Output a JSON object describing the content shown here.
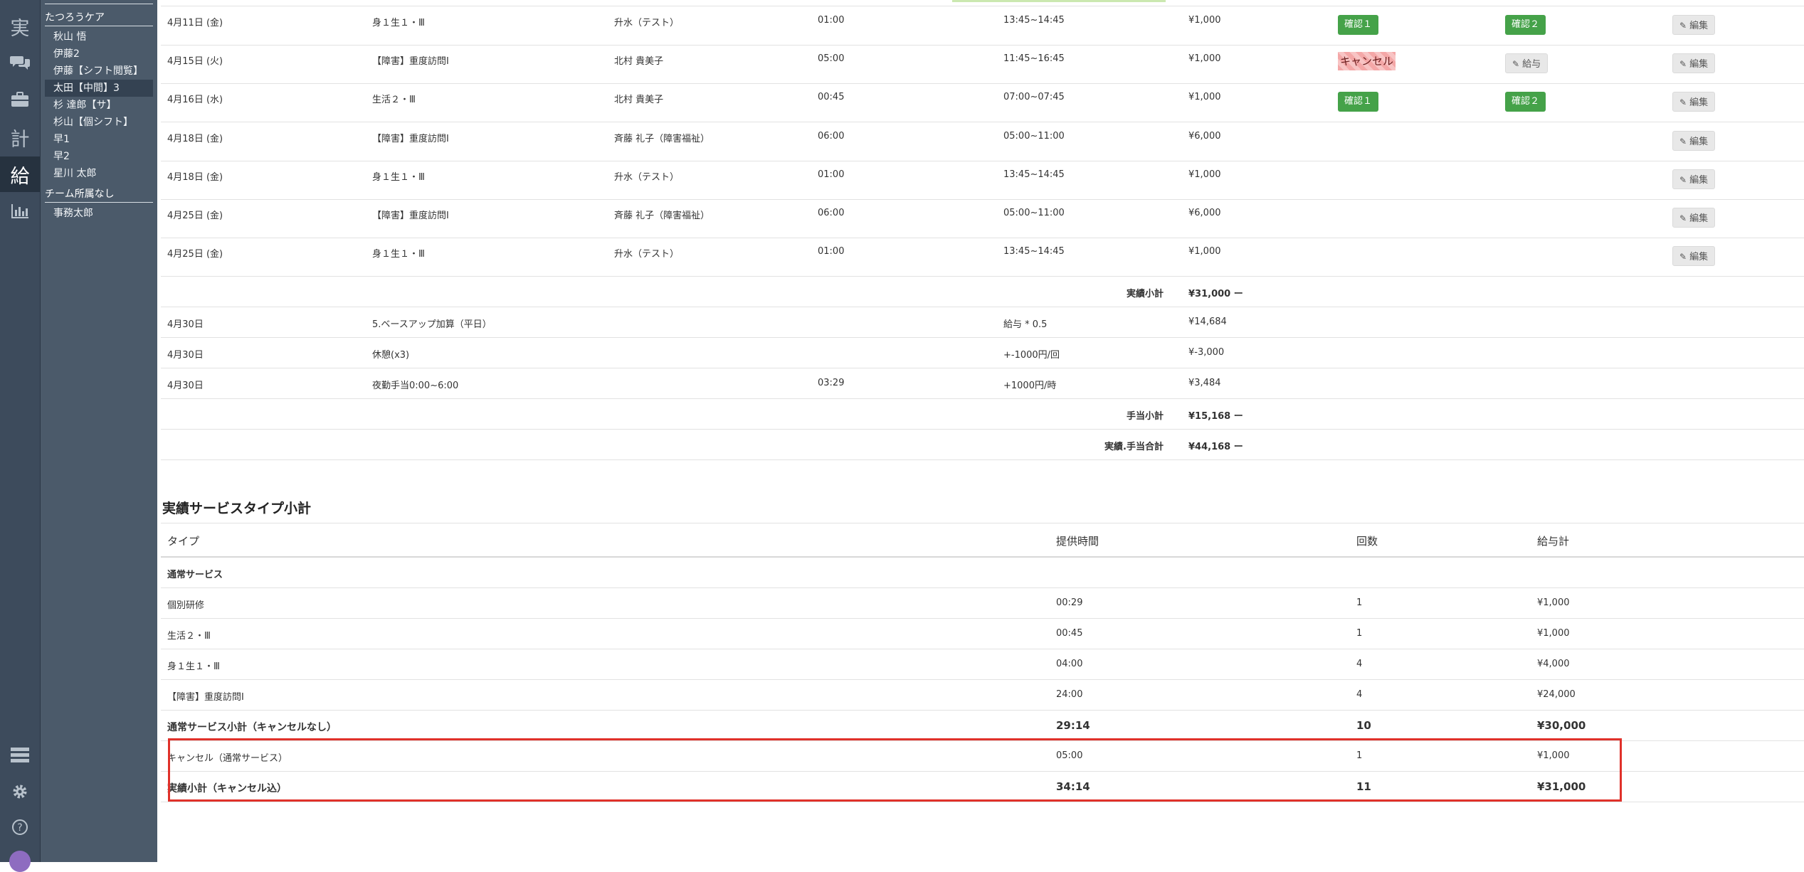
{
  "rail": {
    "items": [
      {
        "name": "rail-jisseki",
        "glyph": "実",
        "active": false
      },
      {
        "name": "rail-chat-icon",
        "glyph": "",
        "active": false
      },
      {
        "name": "rail-briefcase-icon",
        "glyph": "",
        "active": false
      },
      {
        "name": "rail-kei",
        "glyph": "計",
        "active": false
      },
      {
        "name": "rail-kyu",
        "glyph": "給",
        "active": true
      },
      {
        "name": "rail-chart-icon",
        "glyph": "",
        "active": false
      }
    ]
  },
  "sidebar": {
    "team_name": "たつろうケア",
    "members": [
      "秋山 悟",
      "伊藤2",
      "伊藤【シフト閲覧】",
      "太田【中間】3",
      "杉 達郎【サ】",
      "杉山【個シフト】",
      "早1",
      "早2",
      "星川 太郎"
    ],
    "active_member": "太田【中間】3",
    "no_team_label": "チーム所属なし",
    "no_team_members": [
      "事務太郎"
    ]
  },
  "records": [
    {
      "date": "4月11日 (金)",
      "service": "身１生１・Ⅲ",
      "staff": "升水（テスト）",
      "duration": "01:00",
      "time": "13:45~14:45",
      "amount": "¥1,000",
      "c1": "確認１",
      "c2": "確認２",
      "cancel": false,
      "kyuyo": false
    },
    {
      "date": "4月15日 (火)",
      "service": "【障害】重度訪問Ⅰ",
      "staff": "北村 貴美子",
      "duration": "05:00",
      "time": "11:45~16:45",
      "amount": "¥1,000",
      "c1": "",
      "c2": "",
      "cancel": true,
      "kyuyo": true
    },
    {
      "date": "4月16日 (水)",
      "service": "生活２・Ⅲ",
      "staff": "北村 貴美子",
      "duration": "00:45",
      "time": "07:00~07:45",
      "amount": "¥1,000",
      "c1": "確認１",
      "c2": "確認２",
      "cancel": false,
      "kyuyo": false
    },
    {
      "date": "4月18日 (金)",
      "service": "【障害】重度訪問Ⅰ",
      "staff": "斉藤 礼子（障害福祉）",
      "duration": "06:00",
      "time": "05:00~11:00",
      "amount": "¥6,000",
      "c1": "",
      "c2": "",
      "cancel": false,
      "kyuyo": false
    },
    {
      "date": "4月18日 (金)",
      "service": "身１生１・Ⅲ",
      "staff": "升水（テスト）",
      "duration": "01:00",
      "time": "13:45~14:45",
      "amount": "¥1,000",
      "c1": "",
      "c2": "",
      "cancel": false,
      "kyuyo": false
    },
    {
      "date": "4月25日 (金)",
      "service": "【障害】重度訪問Ⅰ",
      "staff": "斉藤 礼子（障害福祉）",
      "duration": "06:00",
      "time": "05:00~11:00",
      "amount": "¥6,000",
      "c1": "",
      "c2": "",
      "cancel": false,
      "kyuyo": false
    },
    {
      "date": "4月25日 (金)",
      "service": "身１生１・Ⅲ",
      "staff": "升水（テスト）",
      "duration": "01:00",
      "time": "13:45~14:45",
      "amount": "¥1,000",
      "c1": "",
      "c2": "",
      "cancel": false,
      "kyuyo": false
    }
  ],
  "labels": {
    "edit": "編集",
    "kyuyo": "給与",
    "cancel": "キャンセル"
  },
  "subtotal_jisseki": {
    "label": "実績小計",
    "value": "¥31,000 ー"
  },
  "allowances": [
    {
      "date": "4月30日",
      "name": "5.ベースアップ加算（平日）",
      "duration": "",
      "rate": "給与 * 0.5",
      "amount": "¥14,684"
    },
    {
      "date": "4月30日",
      "name": "休憩(x3)",
      "duration": "",
      "rate": "+-1000円/回",
      "amount": "¥-3,000"
    },
    {
      "date": "4月30日",
      "name": "夜勤手当0:00~6:00",
      "duration": "03:29",
      "rate": "+1000円/時",
      "amount": "¥3,484"
    }
  ],
  "subtotal_teate": {
    "label": "手当小計",
    "value": "¥15,168 ー"
  },
  "total": {
    "label": "実績.手当合計",
    "value": "¥44,168 ー"
  },
  "summary": {
    "title": "実績サービスタイプ小計",
    "headers": [
      "タイプ",
      "提供時間",
      "回数",
      "給与計"
    ],
    "group_label": "通常サービス",
    "rows": [
      {
        "type": "個別研修",
        "time": "00:29",
        "count": "1",
        "pay": "¥1,000",
        "bold": false
      },
      {
        "type": "生活２・Ⅲ",
        "time": "00:45",
        "count": "1",
        "pay": "¥1,000",
        "bold": false
      },
      {
        "type": "身１生１・Ⅲ",
        "time": "04:00",
        "count": "4",
        "pay": "¥4,000",
        "bold": false
      },
      {
        "type": "【障害】重度訪問Ⅰ",
        "time": "24:00",
        "count": "4",
        "pay": "¥24,000",
        "bold": false
      },
      {
        "type": "通常サービス小計（キャンセルなし）",
        "time": "29:14",
        "count": "10",
        "pay": "¥30,000",
        "bold": true
      },
      {
        "type": "キャンセル（通常サービス）",
        "time": "05:00",
        "count": "1",
        "pay": "¥1,000",
        "bold": false
      },
      {
        "type": "実績小計（キャンセル込）",
        "time": "34:14",
        "count": "11",
        "pay": "¥31,000",
        "bold": true
      }
    ]
  },
  "colors": {
    "rail": "#3d4b5c",
    "sidebar": "#4b5a6a",
    "confirm_green": "#45a249",
    "highlight_red": "#e0312a"
  }
}
